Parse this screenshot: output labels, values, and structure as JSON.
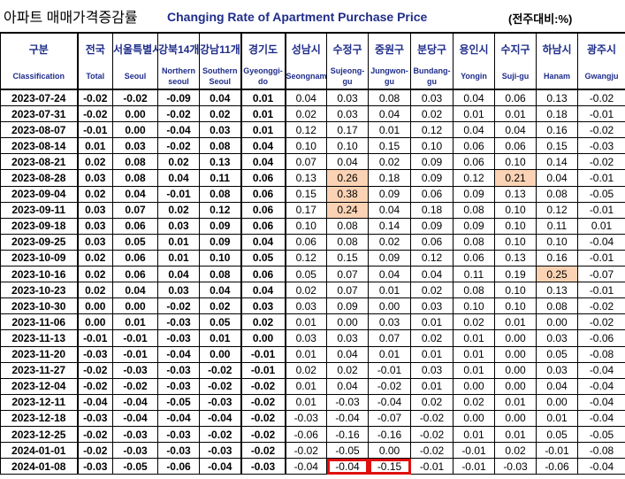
{
  "title": {
    "korean": "아파트 매매가격증감률",
    "english": "Changing Rate of Apartment Purchase Price",
    "unit": "(전주대비:%)"
  },
  "colors": {
    "header_text": "#1f2d8a",
    "highlight": "#fbd3b4",
    "box": "#e01010"
  },
  "chart_data": {
    "type": "table",
    "columns": [
      {
        "ko": "구분",
        "en": "Classification"
      },
      {
        "ko": "전국",
        "en": "Total"
      },
      {
        "ko": "서울특별시",
        "en": "Seoul"
      },
      {
        "ko": "강북14개구",
        "en": "Northern seoul"
      },
      {
        "ko": "강남11개구",
        "en": "Southern Seoul"
      },
      {
        "ko": "경기도",
        "en": "Gyeonggi-do"
      },
      {
        "ko": "성남시",
        "en": "Seongnam"
      },
      {
        "ko": "수정구",
        "en": "Sujeong-gu"
      },
      {
        "ko": "중원구",
        "en": "Jungwon-gu"
      },
      {
        "ko": "분당구",
        "en": "Bundang-gu"
      },
      {
        "ko": "용인시",
        "en": "Yongin"
      },
      {
        "ko": "수지구",
        "en": "Suji-gu"
      },
      {
        "ko": "하남시",
        "en": "Hanam"
      },
      {
        "ko": "광주시",
        "en": "Gwangju"
      }
    ],
    "rows": [
      {
        "date": "2023-07-24",
        "values": [
          "-0.02",
          "-0.02",
          "-0.09",
          "0.04",
          "0.01",
          "0.04",
          "0.03",
          "0.08",
          "0.03",
          "0.04",
          "0.06",
          "0.13",
          "-0.02"
        ]
      },
      {
        "date": "2023-07-31",
        "values": [
          "-0.02",
          "0.00",
          "-0.02",
          "0.02",
          "0.01",
          "0.02",
          "0.03",
          "0.04",
          "0.02",
          "0.01",
          "0.01",
          "0.18",
          "-0.01"
        ]
      },
      {
        "date": "2023-08-07",
        "values": [
          "-0.01",
          "0.00",
          "-0.04",
          "0.03",
          "0.01",
          "0.12",
          "0.17",
          "0.01",
          "0.12",
          "0.04",
          "0.04",
          "0.16",
          "-0.02"
        ]
      },
      {
        "date": "2023-08-14",
        "values": [
          "0.01",
          "0.03",
          "-0.02",
          "0.08",
          "0.04",
          "0.10",
          "0.10",
          "0.15",
          "0.10",
          "0.06",
          "0.06",
          "0.15",
          "-0.03"
        ]
      },
      {
        "date": "2023-08-21",
        "values": [
          "0.02",
          "0.08",
          "0.02",
          "0.13",
          "0.04",
          "0.07",
          "0.04",
          "0.02",
          "0.09",
          "0.06",
          "0.10",
          "0.14",
          "-0.02"
        ]
      },
      {
        "date": "2023-08-28",
        "values": [
          "0.03",
          "0.08",
          "0.04",
          "0.11",
          "0.06",
          "0.13",
          "0.26",
          "0.18",
          "0.09",
          "0.12",
          "0.21",
          "0.04",
          "-0.01"
        ]
      },
      {
        "date": "2023-09-04",
        "values": [
          "0.02",
          "0.04",
          "-0.01",
          "0.08",
          "0.06",
          "0.15",
          "0.38",
          "0.09",
          "0.06",
          "0.09",
          "0.13",
          "0.08",
          "-0.05"
        ]
      },
      {
        "date": "2023-09-11",
        "values": [
          "0.03",
          "0.07",
          "0.02",
          "0.12",
          "0.06",
          "0.17",
          "0.24",
          "0.04",
          "0.18",
          "0.08",
          "0.10",
          "0.12",
          "-0.01"
        ]
      },
      {
        "date": "2023-09-18",
        "values": [
          "0.03",
          "0.06",
          "0.03",
          "0.09",
          "0.06",
          "0.10",
          "0.08",
          "0.14",
          "0.09",
          "0.09",
          "0.10",
          "0.11",
          "0.01"
        ]
      },
      {
        "date": "2023-09-25",
        "values": [
          "0.03",
          "0.05",
          "0.01",
          "0.09",
          "0.04",
          "0.06",
          "0.08",
          "0.02",
          "0.06",
          "0.08",
          "0.10",
          "0.10",
          "-0.04"
        ]
      },
      {
        "date": "2023-10-09",
        "values": [
          "0.02",
          "0.06",
          "0.01",
          "0.10",
          "0.05",
          "0.12",
          "0.15",
          "0.09",
          "0.12",
          "0.06",
          "0.13",
          "0.16",
          "-0.01"
        ]
      },
      {
        "date": "2023-10-16",
        "values": [
          "0.02",
          "0.06",
          "0.04",
          "0.08",
          "0.06",
          "0.05",
          "0.07",
          "0.04",
          "0.04",
          "0.11",
          "0.19",
          "0.25",
          "-0.07"
        ]
      },
      {
        "date": "2023-10-23",
        "values": [
          "0.02",
          "0.04",
          "0.03",
          "0.04",
          "0.04",
          "0.02",
          "0.07",
          "0.01",
          "0.02",
          "0.08",
          "0.10",
          "0.13",
          "-0.01"
        ]
      },
      {
        "date": "2023-10-30",
        "values": [
          "0.00",
          "0.00",
          "-0.02",
          "0.02",
          "0.03",
          "0.03",
          "0.09",
          "0.00",
          "0.03",
          "0.10",
          "0.10",
          "0.08",
          "-0.02"
        ]
      },
      {
        "date": "2023-11-06",
        "values": [
          "0.00",
          "0.01",
          "-0.03",
          "0.05",
          "0.02",
          "0.01",
          "0.00",
          "0.03",
          "0.01",
          "0.02",
          "0.01",
          "0.00",
          "-0.02"
        ]
      },
      {
        "date": "2023-11-13",
        "values": [
          "-0.01",
          "-0.01",
          "-0.03",
          "0.01",
          "0.00",
          "0.03",
          "0.03",
          "0.07",
          "0.02",
          "0.01",
          "0.00",
          "0.03",
          "-0.06"
        ]
      },
      {
        "date": "2023-11-20",
        "values": [
          "-0.03",
          "-0.01",
          "-0.04",
          "0.00",
          "-0.01",
          "0.01",
          "0.04",
          "0.01",
          "0.01",
          "0.01",
          "0.00",
          "0.05",
          "-0.08"
        ]
      },
      {
        "date": "2023-11-27",
        "values": [
          "-0.02",
          "-0.03",
          "-0.03",
          "-0.02",
          "-0.01",
          "0.02",
          "0.02",
          "-0.01",
          "0.03",
          "0.01",
          "0.00",
          "0.03",
          "-0.04"
        ]
      },
      {
        "date": "2023-12-04",
        "values": [
          "-0.02",
          "-0.02",
          "-0.03",
          "-0.02",
          "-0.02",
          "0.01",
          "0.04",
          "-0.02",
          "0.01",
          "0.00",
          "0.00",
          "0.04",
          "-0.04"
        ]
      },
      {
        "date": "2023-12-11",
        "values": [
          "-0.04",
          "-0.04",
          "-0.05",
          "-0.03",
          "-0.02",
          "0.01",
          "-0.03",
          "-0.04",
          "0.02",
          "0.02",
          "0.01",
          "0.00",
          "-0.04"
        ]
      },
      {
        "date": "2023-12-18",
        "values": [
          "-0.03",
          "-0.04",
          "-0.04",
          "-0.04",
          "-0.02",
          "-0.03",
          "-0.04",
          "-0.07",
          "-0.02",
          "0.00",
          "0.00",
          "0.01",
          "-0.04"
        ]
      },
      {
        "date": "2023-12-25",
        "values": [
          "-0.02",
          "-0.03",
          "-0.03",
          "-0.02",
          "-0.02",
          "-0.06",
          "-0.16",
          "-0.16",
          "-0.02",
          "0.01",
          "0.01",
          "0.05",
          "-0.05"
        ]
      },
      {
        "date": "2024-01-01",
        "values": [
          "-0.02",
          "-0.03",
          "-0.03",
          "-0.03",
          "-0.02",
          "-0.02",
          "-0.05",
          "0.00",
          "-0.02",
          "-0.01",
          "0.02",
          "-0.01",
          "-0.08"
        ]
      },
      {
        "date": "2024-01-08",
        "values": [
          "-0.03",
          "-0.05",
          "-0.06",
          "-0.04",
          "-0.03",
          "-0.04",
          "-0.04",
          "-0.15",
          "-0.01",
          "-0.01",
          "-0.03",
          "-0.06",
          "-0.04"
        ]
      }
    ],
    "highlighted_cells": [
      {
        "date": "2023-08-28",
        "column": "Sujeong-gu"
      },
      {
        "date": "2023-08-28",
        "column": "Suji-gu"
      },
      {
        "date": "2023-09-04",
        "column": "Sujeong-gu"
      },
      {
        "date": "2023-09-11",
        "column": "Sujeong-gu"
      },
      {
        "date": "2023-10-16",
        "column": "Hanam"
      }
    ],
    "boxed_cells": [
      {
        "date": "2024-01-08",
        "column": "Sujeong-gu"
      },
      {
        "date": "2024-01-08",
        "column": "Jungwon-gu"
      }
    ]
  }
}
